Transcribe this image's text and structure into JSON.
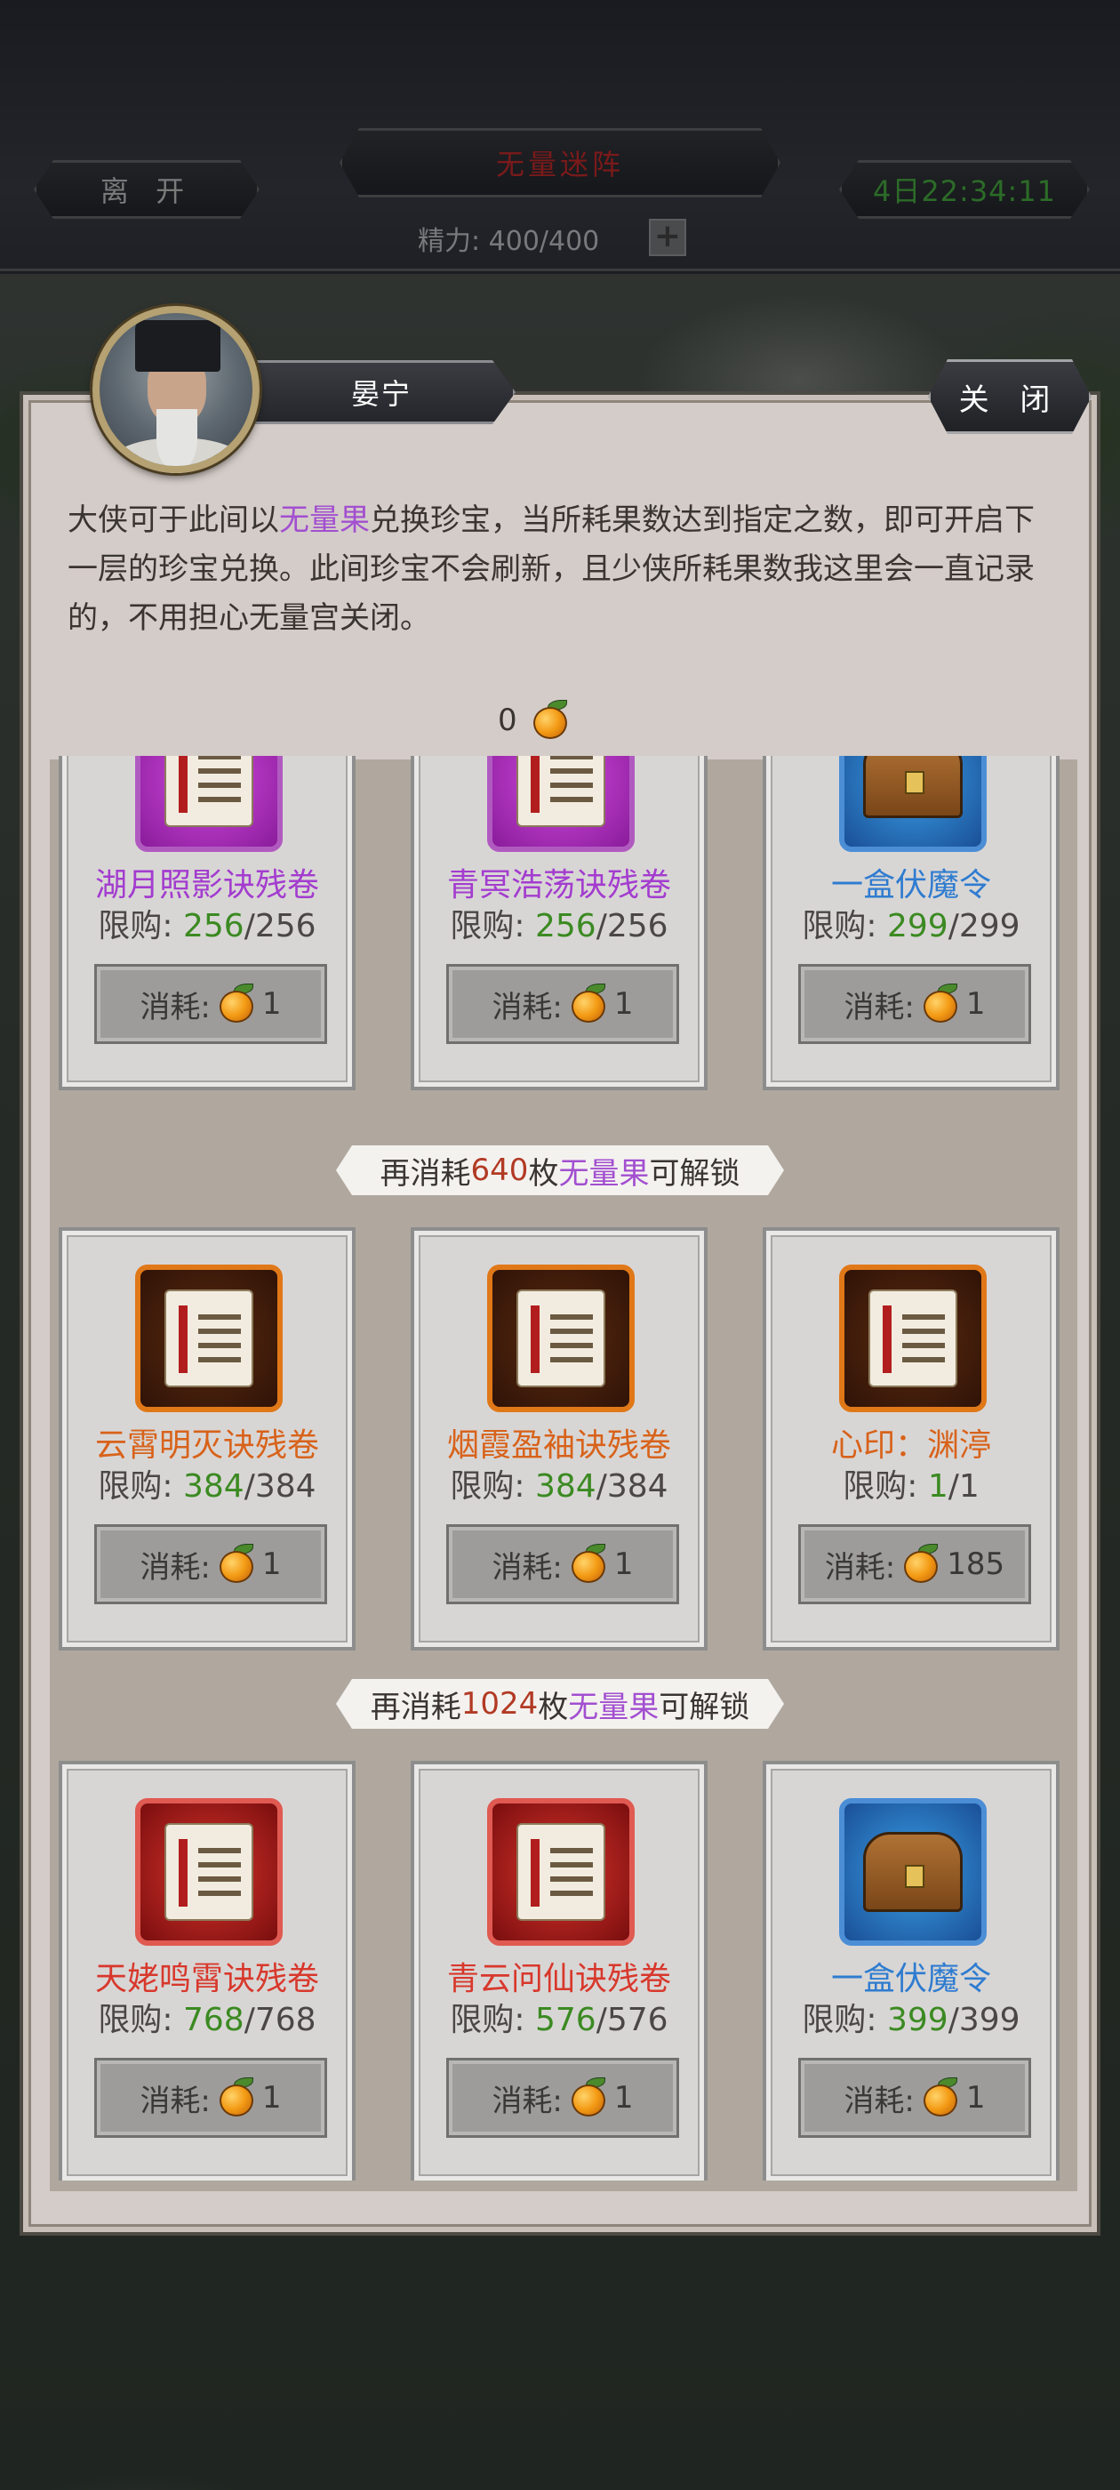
{
  "header": {
    "leave_label": "离 开",
    "title": "无量迷阵",
    "timer": "4日22:34:11",
    "energy_label": "精力: 400/400",
    "energy_plus": "+"
  },
  "npc": {
    "name": "晏宁",
    "close_label": "关 闭"
  },
  "description": {
    "part1": "大侠可于此间以",
    "highlight": "无量果",
    "part2": "兑换珍宝，当所耗果数达到指定之数，即可开启下一层的珍宝兑换。此间珍宝不会刷新，且少侠所耗果数我这里会一直记录的，不用担心无量宫关闭。"
  },
  "balance": {
    "count": "0",
    "icon": "fruit-icon"
  },
  "labels": {
    "limit": "限购: ",
    "cost": "消耗: "
  },
  "rows": [
    {
      "items": [
        {
          "name": "湖月照影诀残卷",
          "current": "256",
          "max": "/256",
          "cost": "1",
          "quality": "purple",
          "icon": "scroll-icon"
        },
        {
          "name": "青冥浩荡诀残卷",
          "current": "256",
          "max": "/256",
          "cost": "1",
          "quality": "purple",
          "icon": "scroll-icon"
        },
        {
          "name": "一盒伏魔令",
          "current": "299",
          "max": "/299",
          "cost": "1",
          "quality": "blue",
          "icon": "chest-icon"
        }
      ]
    },
    {
      "unlock": {
        "prefix": "再消耗",
        "amount": "640",
        "mid": "枚",
        "fruit": "无量果",
        "suffix": "可解锁"
      },
      "items": [
        {
          "name": "云霄明灭诀残卷",
          "current": "384",
          "max": "/384",
          "cost": "1",
          "quality": "orange",
          "icon": "scroll-icon"
        },
        {
          "name": "烟霞盈袖诀残卷",
          "current": "384",
          "max": "/384",
          "cost": "1",
          "quality": "orange",
          "icon": "scroll-icon"
        },
        {
          "name": "心印：渊渟",
          "current": "1",
          "max": "/1",
          "cost": "185",
          "quality": "orange",
          "icon": "scroll-icon"
        }
      ]
    },
    {
      "unlock": {
        "prefix": "再消耗",
        "amount": "1024",
        "mid": "枚",
        "fruit": "无量果",
        "suffix": "可解锁"
      },
      "items": [
        {
          "name": "天姥鸣霄诀残卷",
          "current": "768",
          "max": "/768",
          "cost": "1",
          "quality": "red",
          "icon": "scroll-icon"
        },
        {
          "name": "青云问仙诀残卷",
          "current": "576",
          "max": "/576",
          "cost": "1",
          "quality": "red",
          "icon": "scroll-icon"
        },
        {
          "name": "一盒伏魔令",
          "current": "399",
          "max": "/399",
          "cost": "1",
          "quality": "blue",
          "icon": "chest-icon"
        }
      ]
    }
  ]
}
